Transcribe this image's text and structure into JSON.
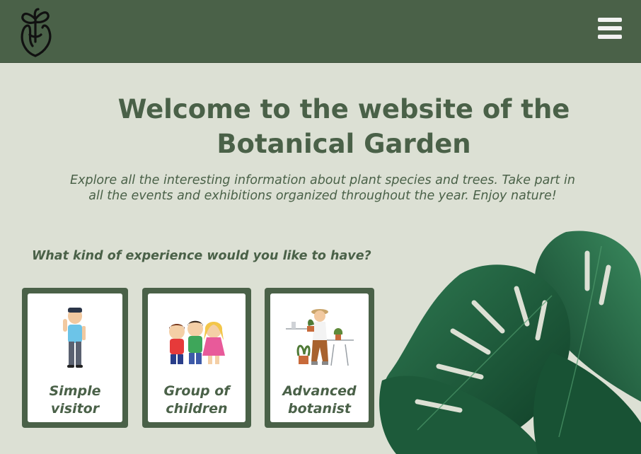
{
  "header": {
    "logo_icon": "flower-logo-icon",
    "menu_icon": "hamburger-menu-icon",
    "background": "#4a6148"
  },
  "hero": {
    "title_line1": "Welcome to the website of the",
    "title_line2": "Botanical Garden",
    "subtitle_line1": "Explore all the interesting information about plant species and trees.  Take part in",
    "subtitle_line2": "all the events and exhibitions organized throughout the year. Enjoy nature!"
  },
  "experience": {
    "question": "What kind of experience would you like to have?",
    "options": [
      {
        "line1": "Simple",
        "line2": "visitor",
        "icon": "visitor-boy-icon"
      },
      {
        "line1": "Group of",
        "line2": "children",
        "icon": "children-group-icon"
      },
      {
        "line1": "Advanced",
        "line2": "botanist",
        "icon": "botanist-icon"
      }
    ]
  },
  "colors": {
    "accent": "#4a6148",
    "page_background": "#dce0d4",
    "card_background": "#ffffff"
  }
}
